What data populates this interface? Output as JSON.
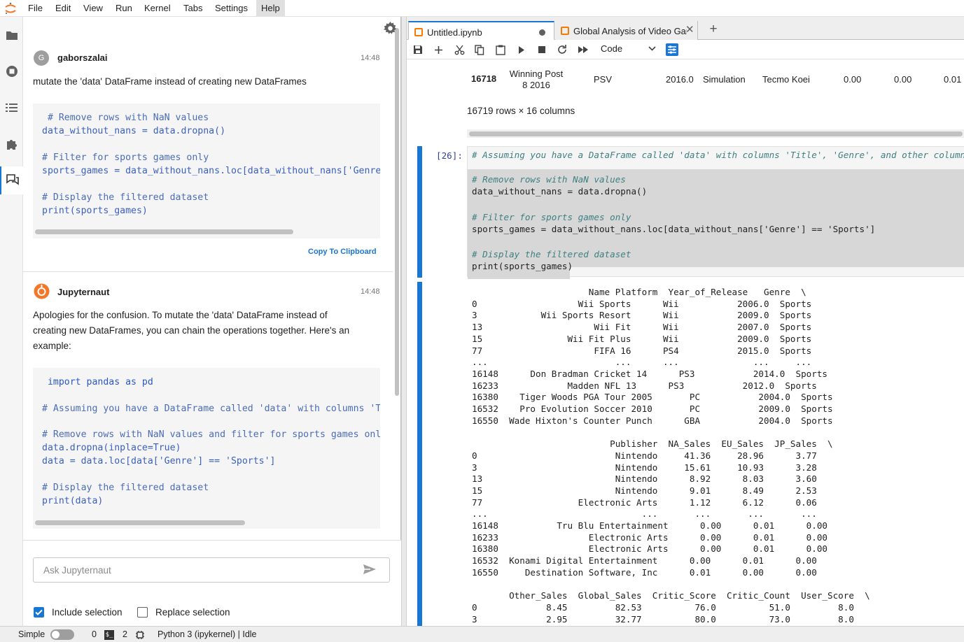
{
  "menubar": {
    "items": [
      "File",
      "Edit",
      "View",
      "Run",
      "Kernel",
      "Tabs",
      "Settings",
      "Help"
    ],
    "active": "Help"
  },
  "chat": {
    "messages": [
      {
        "author": "gaborszalai",
        "avatar": "G",
        "time": "14:48",
        "text": "mutate the 'data' DataFrame instead of creating new DataFrames",
        "code": [
          " # Remove rows with NaN values",
          "data_without_nans = data.dropna()",
          "",
          "# Filter for sports games only",
          "sports_games = data_without_nans.loc[data_without_nans['Genre'] == 'Sports']",
          "",
          "# Display the filtered dataset",
          "print(sports_games)"
        ],
        "copy_label": "Copy To Clipboard"
      },
      {
        "author": "Jupyternaut",
        "time": "14:48",
        "text_lines": [
          "Apologies for the confusion. To mutate the 'data' DataFrame instead of",
          "creating new DataFrames, you can chain the operations together. Here's an",
          "example:"
        ],
        "code": [
          " import pandas as pd",
          "",
          "# Assuming you have a DataFrame called 'data' with columns 'Title', 'Genre', and other columns",
          "",
          "# Remove rows with NaN values and filter for sports games only",
          "data.dropna(inplace=True)",
          "data = data.loc[data['Genre'] == 'Sports']",
          "",
          "# Display the filtered dataset",
          "print(data)"
        ],
        "copy_label": "Copy To Clipboard"
      }
    ],
    "input_placeholder": "Ask Jupyternaut",
    "include_selection_label": "Include selection",
    "include_selection_checked": true,
    "replace_selection_label": "Replace selection",
    "replace_selection_checked": false
  },
  "tabs": [
    {
      "label": "Untitled.ipynb",
      "active": true,
      "modified": true
    },
    {
      "label": "Global Analysis of Video Games",
      "active": false
    }
  ],
  "toolbar": {
    "cell_type": "Code"
  },
  "notebook": {
    "top_row": {
      "index": "16718",
      "name_l1": "Winning Post",
      "name_l2": "8 2016",
      "platform": "PSV",
      "year": "2016.0",
      "genre": "Simulation",
      "publisher": "Tecmo Koei",
      "v1": "0.00",
      "v2": "0.00",
      "v3": "0.01"
    },
    "shape_text": "16719 rows × 16 columns",
    "cell_prompt": "[26]:",
    "cell_lines": [
      "# Assuming you have a DataFrame called 'data' with columns 'Title', 'Genre', and other columns",
      "",
      "# Remove rows with NaN values",
      "data_without_nans = data.dropna()",
      "",
      "# Filter for sports games only",
      "sports_games = data_without_nans.loc[data_without_nans['Genre'] == 'Sports']",
      "",
      "# Display the filtered dataset",
      "print(sports_games)"
    ],
    "output_lines": [
      "                      Name Platform  Year_of_Release   Genre  \\",
      "0                   Wii Sports      Wii           2006.0  Sports",
      "3            Wii Sports Resort      Wii           2009.0  Sports",
      "13                     Wii Fit      Wii           2007.0  Sports",
      "15                Wii Fit Plus      Wii           2009.0  Sports",
      "77                     FIFA 16      PS4           2015.0  Sports",
      "...                        ...      ...              ...     ...",
      "16148      Don Bradman Cricket 14      PS3           2014.0  Sports",
      "16233             Madden NFL 13      PS3           2012.0  Sports",
      "16380    Tiger Woods PGA Tour 2005       PC           2004.0  Sports",
      "16532    Pro Evolution Soccer 2010       PC           2009.0  Sports",
      "16550  Wade Hixton's Counter Punch      GBA           2004.0  Sports",
      "",
      "                          Publisher  NA_Sales  EU_Sales  JP_Sales  \\",
      "0                          Nintendo     41.36     28.96      3.77",
      "3                          Nintendo     15.61     10.93      3.28",
      "13                         Nintendo      8.92      8.03      3.60",
      "15                         Nintendo      9.01      8.49      2.53",
      "77                  Electronic Arts      1.12      6.12      0.06",
      "...                             ...       ...       ...       ...",
      "16148           Tru Blu Entertainment      0.00      0.01      0.00",
      "16233                 Electronic Arts      0.00      0.01      0.00",
      "16380                 Electronic Arts      0.00      0.01      0.00",
      "16532  Konami Digital Entertainment      0.00      0.01      0.00",
      "16550     Destination Software, Inc      0.01      0.00      0.00",
      "",
      "       Other_Sales  Global_Sales  Critic_Score  Critic_Count  User_Score  \\",
      "0             8.45         82.53          76.0          51.0         8.0",
      "3             2.95         32.77          80.0          73.0         8.0"
    ]
  },
  "statusbar": {
    "mode": "Simple",
    "count1": "0",
    "count2": "2",
    "kernel": "Python 3 (ipykernel) | Idle"
  }
}
